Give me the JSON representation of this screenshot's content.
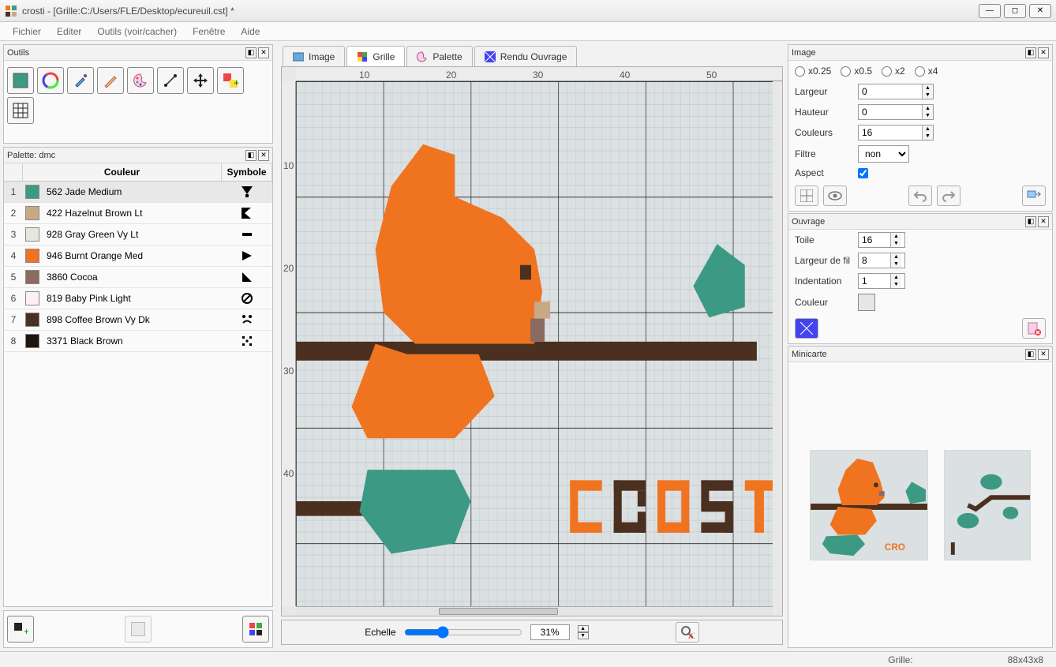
{
  "window": {
    "title": "crosti - [Grille:C:/Users/FLE/Desktop/ecureuil.cst] *"
  },
  "menu": [
    "Fichier",
    "Editer",
    "Outils (voir/cacher)",
    "Fenêtre",
    "Aide"
  ],
  "panels": {
    "outils": {
      "title": "Outils"
    },
    "palette": {
      "title": "Palette: dmc",
      "headers": {
        "color": "Couleur",
        "symbol": "Symbole"
      }
    },
    "image": {
      "title": "Image",
      "zoom": [
        "x0.25",
        "x0.5",
        "x2",
        "x4"
      ],
      "labels": {
        "largeur": "Largeur",
        "hauteur": "Hauteur",
        "couleurs": "Couleurs",
        "filtre": "Filtre",
        "aspect": "Aspect"
      },
      "values": {
        "largeur": "0",
        "hauteur": "0",
        "couleurs": "16",
        "filtre": "non",
        "aspect": true
      }
    },
    "ouvrage": {
      "title": "Ouvrage",
      "labels": {
        "toile": "Toile",
        "largeur_fil": "Largeur de fil",
        "indentation": "Indentation",
        "couleur": "Couleur"
      },
      "values": {
        "toile": "16",
        "largeur_fil": "8",
        "indentation": "1"
      }
    },
    "minicarte": {
      "title": "Minicarte"
    }
  },
  "tabs": [
    {
      "label": "Image",
      "active": false
    },
    {
      "label": "Grille",
      "active": true
    },
    {
      "label": "Palette",
      "active": false
    },
    {
      "label": "Rendu Ouvrage",
      "active": false
    }
  ],
  "palette": [
    {
      "idx": "1",
      "color": "#3c9a84",
      "name": "562 Jade Medium",
      "sel": true
    },
    {
      "idx": "2",
      "color": "#c9a985",
      "name": "422 Hazelnut Brown Lt",
      "sel": false
    },
    {
      "idx": "3",
      "color": "#e6e6de",
      "name": "928 Gray Green Vy Lt",
      "sel": false
    },
    {
      "idx": "4",
      "color": "#f07420",
      "name": "946 Burnt Orange Med",
      "sel": false
    },
    {
      "idx": "5",
      "color": "#8a6a61",
      "name": "3860 Cocoa",
      "sel": false
    },
    {
      "idx": "6",
      "color": "#ffeff1",
      "name": "819 Baby Pink Light",
      "sel": false
    },
    {
      "idx": "7",
      "color": "#4b2f1f",
      "name": "898 Coffee Brown Vy Dk",
      "sel": false
    },
    {
      "idx": "8",
      "color": "#1e1410",
      "name": "3371 Black Brown",
      "sel": false
    }
  ],
  "ruler_h": [
    "10",
    "20",
    "30",
    "40",
    "50"
  ],
  "ruler_v": [
    "10",
    "20",
    "30",
    "40"
  ],
  "scale": {
    "label": "Echelle",
    "value": "31%"
  },
  "status": {
    "grille": "Grille:",
    "dims": "88x43x8"
  }
}
